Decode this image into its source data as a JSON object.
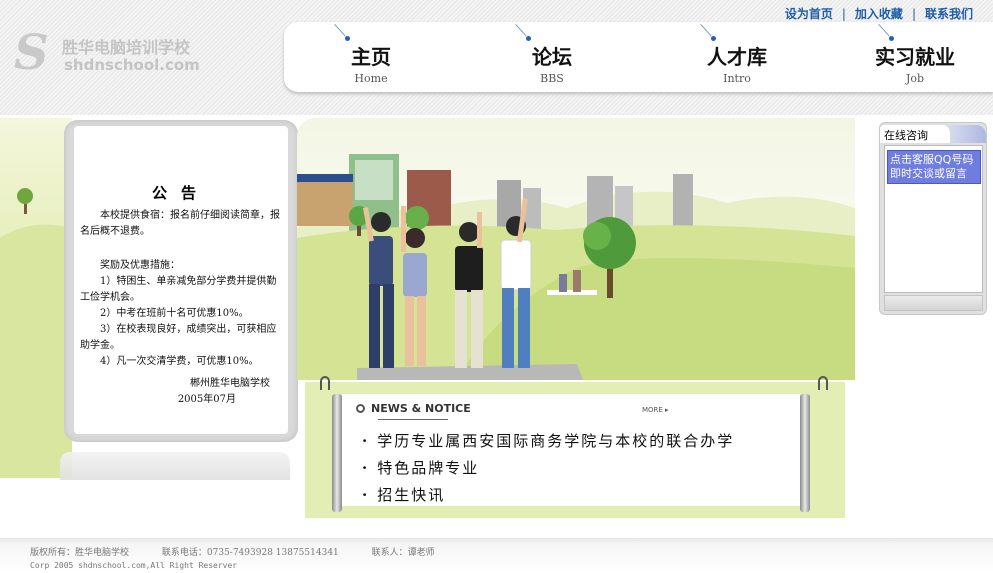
{
  "header": {
    "logo": {
      "cn": "胜华电脑培训学校",
      "en": "shdnschool.com"
    },
    "top_links": [
      "设为首页",
      "加入收藏",
      "联系我们"
    ],
    "top_links_separator": "|",
    "nav": [
      {
        "cn": "主页",
        "en": "Home"
      },
      {
        "cn": "论坛",
        "en": "BBS"
      },
      {
        "cn": "人才库",
        "en": "Intro"
      },
      {
        "cn": "实习就业",
        "en": "Job"
      }
    ]
  },
  "notice": {
    "title": "公告",
    "intro": "本校提供食宿：报名前仔细阅读简章，报名后概不退费。",
    "measures_title": "奖励及优惠措施：",
    "items": [
      "1）特困生、单亲减免部分学费并提供勤工俭学机会。",
      "2）中考在班前十名可优惠10%。",
      "3）在校表现良好，成绩突出，可获相应助学金。",
      "4）凡一次交清学费，可优惠10%。"
    ],
    "signature": "郴州胜华电脑学校",
    "date": "2005年07月"
  },
  "news": {
    "heading": "NEWS & NOTICE",
    "more": "MORE ▸",
    "items": [
      "学历专业属西安国际商务学院与本校的联合办学",
      "特色品牌专业",
      "招生快讯"
    ]
  },
  "consult": {
    "tab": "在线咨询",
    "link": "点击客服QQ号码即时交谈或留言"
  },
  "footer": {
    "copyright": "版权所有：胜华电脑学校",
    "phone": "联系电话：0735-7493928 13875514341",
    "contact": "联系人：谭老师",
    "corp": "Corp 2005 shdnschool.com,All Right Reserver"
  }
}
